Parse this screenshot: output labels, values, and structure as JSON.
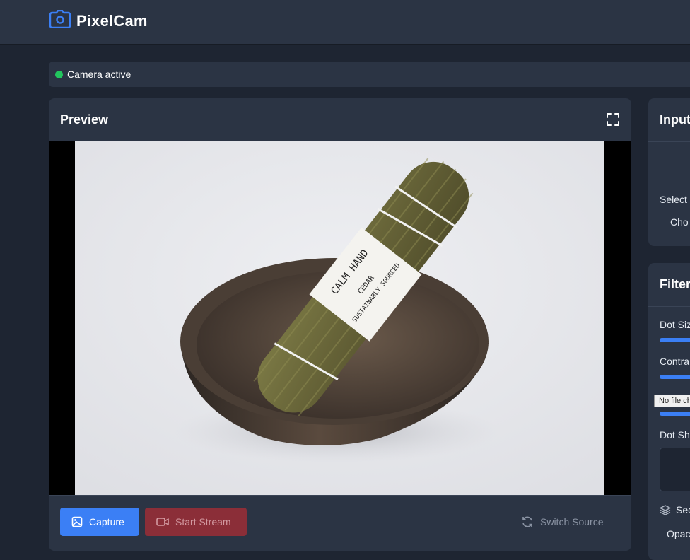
{
  "app": {
    "title": "PixelCam",
    "brand_color": "#3b7ff5"
  },
  "status": {
    "text": "Camera active",
    "color": "#22c55e"
  },
  "preview": {
    "title": "Preview",
    "fullscreen_icon": "fullscreen-icon",
    "photo_alt": "Cedar smudge bundle with white label in dark ceramic bowl",
    "label_lines": [
      "CALM HAND",
      "CEDAR",
      "SUSTAINABLY SOURCED"
    ]
  },
  "controls": {
    "capture_label": "Capture",
    "stream_label": "Start Stream",
    "switch_label": "Switch Source"
  },
  "input_panel": {
    "title": "Input",
    "select_label": "Select",
    "choose_label": "Cho"
  },
  "filters_panel": {
    "title": "Filter",
    "dot_size_label": "Dot Siz",
    "contrast_label": "Contra",
    "dot_shape_label": "Dot Sh",
    "secondary_label": "Sec",
    "opacity_label": "Opac"
  },
  "tooltip": {
    "text": "No file chosen"
  }
}
